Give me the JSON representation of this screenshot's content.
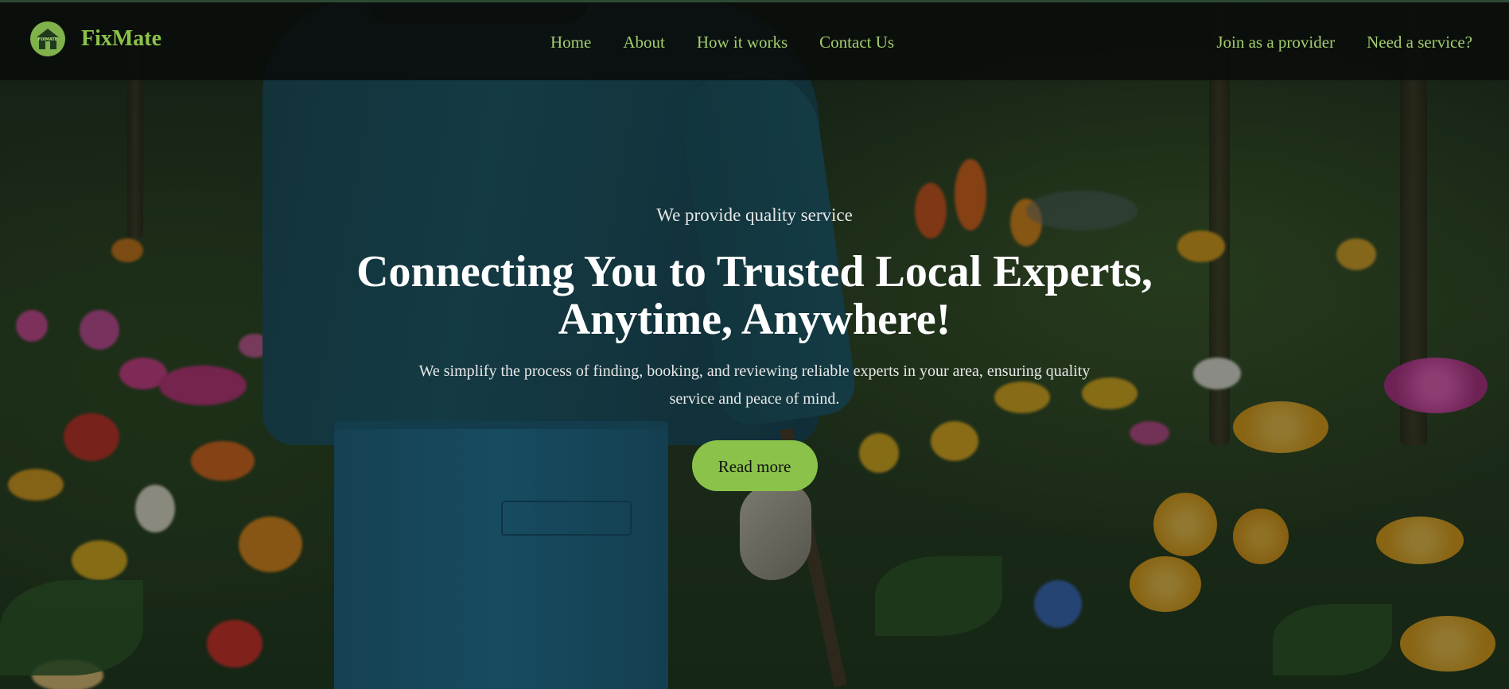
{
  "brand": {
    "logo_text": "FIXMATE",
    "name": "FixMate"
  },
  "nav": {
    "links": [
      {
        "label": "Home"
      },
      {
        "label": "About"
      },
      {
        "label": "How it works"
      },
      {
        "label": "Contact Us"
      }
    ],
    "right_links": [
      {
        "label": "Join as a provider"
      },
      {
        "label": "Need a service?"
      }
    ]
  },
  "hero": {
    "tagline": "We provide quality service",
    "headline": "Connecting You to Trusted Local Experts, Anytime, Anywhere!",
    "subtext": "We simplify the process of finding, booking, and reviewing reliable experts in your area, ensuring quality service and peace of mind.",
    "cta_label": "Read more"
  },
  "colors": {
    "accent": "#8bc34a",
    "nav_link": "#a3cd6e",
    "nav_bg": "#0a0c0a"
  },
  "icons": {
    "logo": "house-logo-icon"
  }
}
